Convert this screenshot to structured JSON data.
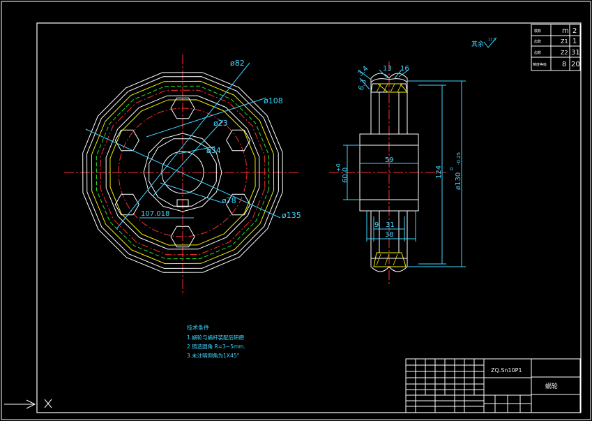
{
  "drawing": {
    "gear_dims": {
      "d82": "ø82",
      "d108": "ø108",
      "d23": "ø23",
      "d34": "ø34",
      "d78": "ø78",
      "d135": "ø135",
      "chord": "107.018"
    },
    "section_dims": {
      "d3_4": "3.4",
      "d13": "13",
      "d16": "16",
      "d6_3": "6.3",
      "hub_width": "59",
      "bore": "60.0",
      "bore_tol": "+0",
      "height124": "124",
      "d130": "ø130",
      "d130_tol": "0",
      "d130_tol2": "-0.25",
      "d9": "9",
      "d31": "31",
      "d38": "38"
    },
    "roughness": {
      "label": "其余",
      "value": "12.5"
    },
    "param_table": {
      "rows": [
        {
          "name": "模数",
          "sym": "m",
          "val": "2"
        },
        {
          "name": "齿数",
          "sym": "Z1",
          "val": "1"
        },
        {
          "name": "齿数",
          "sym": "Z2",
          "val": "31"
        },
        {
          "name": "精度等级",
          "sym": "8",
          "val": "20"
        }
      ]
    },
    "notes": {
      "title": "技术条件",
      "items": [
        "1.蜗轮与蜗杆装配后研磨",
        "2.铸造圆角 R=3~5mm.",
        "3.未注明倒角为1X45°"
      ]
    },
    "title_block": {
      "material": "ZQ.Sn10P1",
      "part_name": "蜗轮"
    }
  }
}
